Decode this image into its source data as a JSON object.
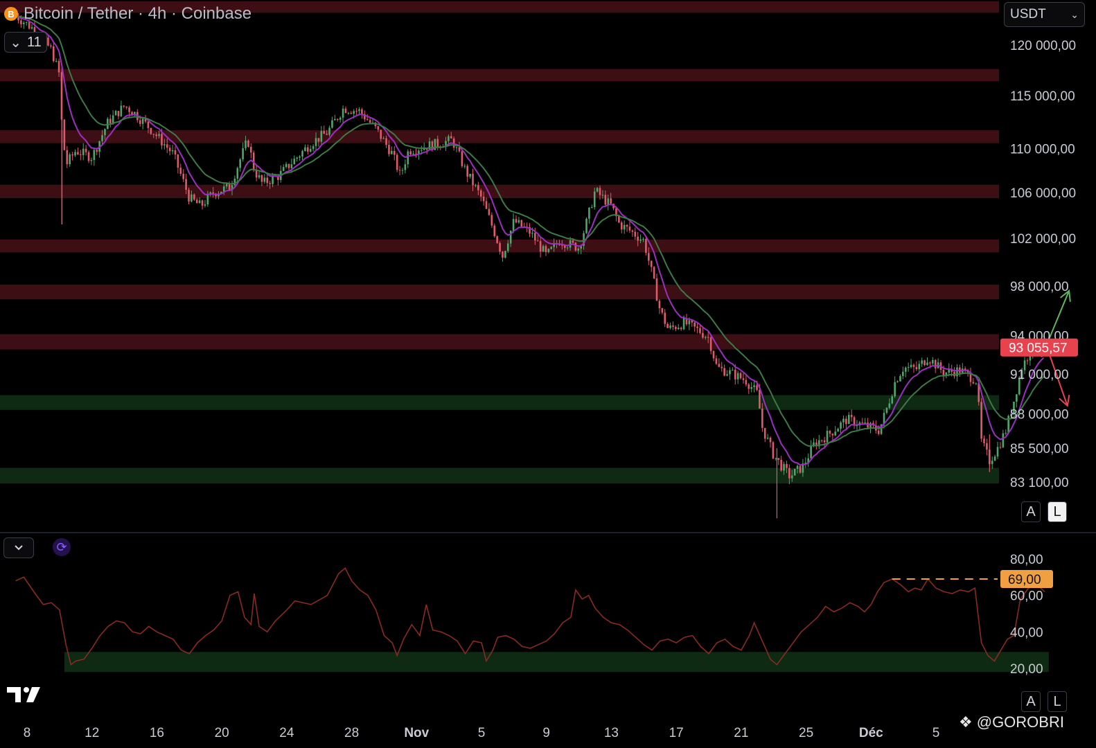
{
  "header": {
    "symbol_icon": "B",
    "title": "Bitcoin / Tether · 4h · Coinbase",
    "indicator_count": "11",
    "currency": "USDT",
    "scale_buttons": {
      "auto": "A",
      "log": "L"
    }
  },
  "footer": {
    "watermark": "@GOROBRI"
  },
  "colors": {
    "background": "#000000",
    "resistance_zone": "#3d0f14",
    "support_zone": "#0f2a12",
    "candle_up": "#4fa66a",
    "candle_down": "#e05a6a",
    "ema_fast": "#9b30c0",
    "ema_slow": "#3d7a47",
    "rsi_line": "#8a2a22",
    "price_label": "#e8424f",
    "rsi_label": "#f0a040",
    "arrow_up": "#5cb85c",
    "arrow_down": "#e8424f"
  },
  "chart_data": [
    {
      "type": "candlestick",
      "title": "Bitcoin / Tether · 4h · Coinbase",
      "timeframe": "4h",
      "y_scale": "log",
      "ylim": [
        80500,
        124500
      ],
      "x_range_days": [
        7.3,
        38.5
      ],
      "y_ticks": [
        "120 000,00",
        "115 000,00",
        "110 000,00",
        "106 000,00",
        "102 000,00",
        "98 000,00",
        "94 000,00",
        "91 000,00",
        "88 000,00",
        "85 500,00",
        "83 100,00"
      ],
      "y_tick_values": [
        120000,
        115000,
        110000,
        106000,
        102000,
        98000,
        94000,
        91000,
        88000,
        85500,
        83100
      ],
      "x_ticks": [
        "8",
        "12",
        "16",
        "20",
        "24",
        "28",
        "Nov",
        "5",
        "9",
        "13",
        "17",
        "21",
        "25",
        "Déc",
        "5"
      ],
      "x_tick_days": [
        8,
        12,
        16,
        20,
        24,
        28,
        32,
        36,
        40,
        44,
        48,
        52,
        56,
        60,
        64
      ],
      "last_price": "93 055,57",
      "resistance_zones": [
        [
          123300,
          124500
        ],
        [
          116400,
          117600
        ],
        [
          110500,
          111700
        ],
        [
          105500,
          106700
        ],
        [
          100800,
          101900
        ],
        [
          96900,
          98100
        ],
        [
          92900,
          94100
        ]
      ],
      "support_zones": [
        [
          88300,
          89400
        ],
        [
          83000,
          84100
        ]
      ],
      "price_path": [
        [
          7.3,
          123000
        ],
        [
          8.5,
          121500
        ],
        [
          9.5,
          119500
        ],
        [
          10.0,
          117000
        ],
        [
          10.15,
          112000
        ],
        [
          10.4,
          108500
        ],
        [
          11,
          109800
        ],
        [
          12,
          109200
        ],
        [
          13,
          112500
        ],
        [
          14,
          114000
        ],
        [
          14.5,
          113500
        ],
        [
          15.5,
          112000
        ],
        [
          17,
          109500
        ],
        [
          18,
          105500
        ],
        [
          18.7,
          104800
        ],
        [
          19.5,
          106000
        ],
        [
          20.5,
          106500
        ],
        [
          21,
          108500
        ],
        [
          21.6,
          110800
        ],
        [
          22,
          108000
        ],
        [
          22.5,
          106800
        ],
        [
          23.5,
          107500
        ],
        [
          24.5,
          109000
        ],
        [
          25.5,
          110500
        ],
        [
          26.5,
          111500
        ],
        [
          27.5,
          113800
        ],
        [
          28.5,
          113500
        ],
        [
          29.5,
          111800
        ],
        [
          30.5,
          109500
        ],
        [
          31,
          107500
        ],
        [
          31.5,
          109800
        ],
        [
          32.5,
          110200
        ],
        [
          33.5,
          110500
        ],
        [
          34.2,
          110800
        ],
        [
          35,
          108000
        ],
        [
          36,
          105500
        ],
        [
          36.8,
          102500
        ],
        [
          37.3,
          100500
        ],
        [
          38,
          103500
        ],
        [
          39,
          102500
        ],
        [
          40,
          100500
        ],
        [
          40.8,
          101800
        ],
        [
          42,
          101200
        ],
        [
          42.5,
          103500
        ],
        [
          43,
          106200
        ],
        [
          44,
          104800
        ],
        [
          44.5,
          103200
        ],
        [
          45,
          102800
        ],
        [
          46,
          101800
        ],
        [
          46.5,
          99000
        ],
        [
          47,
          96000
        ],
        [
          47.5,
          94500
        ],
        [
          48.5,
          95000
        ],
        [
          49.5,
          94300
        ],
        [
          50,
          93800
        ],
        [
          50.5,
          91500
        ],
        [
          51.5,
          91000
        ],
        [
          52.3,
          90500
        ],
        [
          53,
          89500
        ],
        [
          53.3,
          87000
        ],
        [
          54,
          85000
        ],
        [
          54.5,
          84200
        ],
        [
          55,
          83500
        ],
        [
          55.8,
          84200
        ],
        [
          56.5,
          85800
        ],
        [
          57.5,
          86600
        ],
        [
          58.5,
          87600
        ],
        [
          59.5,
          87200
        ],
        [
          60.5,
          86800
        ],
        [
          61,
          88500
        ],
        [
          61.5,
          90500
        ],
        [
          62,
          91500
        ],
        [
          62.8,
          91400
        ],
        [
          63.5,
          92300
        ],
        [
          64.5,
          91100
        ],
        [
          65.5,
          91300
        ],
        [
          66.5,
          90500
        ],
        [
          66.8,
          86000
        ],
        [
          67.3,
          84600
        ],
        [
          67.8,
          85500
        ],
        [
          68.3,
          86800
        ],
        [
          68.8,
          89000
        ],
        [
          69.3,
          91500
        ],
        [
          69.8,
          92800
        ],
        [
          70.3,
          93400
        ],
        [
          70.7,
          93055.57
        ]
      ],
      "series": [
        {
          "name": "EMA (fast)",
          "color": "#9b30c0"
        },
        {
          "name": "EMA (slow)",
          "color": "#3d7a47"
        }
      ],
      "annotations": [
        {
          "type": "arrow",
          "direction": "up",
          "from": [
            70.8,
            93200
          ],
          "to": [
            72.2,
            97600
          ],
          "color": "#5cb85c"
        },
        {
          "type": "arrow",
          "direction": "down",
          "from": [
            70.8,
            93200
          ],
          "to": [
            72.1,
            88600
          ],
          "color": "#e8424f"
        }
      ]
    },
    {
      "type": "line",
      "ylim": [
        12,
        88
      ],
      "y_ticks": [
        "80,00",
        "60,00",
        "40,00",
        "20,00"
      ],
      "y_tick_values": [
        80,
        60,
        40,
        20
      ],
      "current_value_label": "69,00",
      "level_line": 69,
      "oversold_zone": [
        18,
        29
      ],
      "values_path": [
        [
          7.3,
          68
        ],
        [
          7.8,
          70
        ],
        [
          8.5,
          61
        ],
        [
          9.0,
          55
        ],
        [
          9.5,
          56
        ],
        [
          10.0,
          52
        ],
        [
          10.4,
          33
        ],
        [
          10.7,
          22
        ],
        [
          11.0,
          24
        ],
        [
          11.5,
          25
        ],
        [
          12,
          31
        ],
        [
          12.5,
          38
        ],
        [
          13,
          43
        ],
        [
          13.5,
          46
        ],
        [
          14,
          45
        ],
        [
          14.5,
          40
        ],
        [
          15,
          39
        ],
        [
          15.5,
          43
        ],
        [
          16,
          40
        ],
        [
          16.5,
          38
        ],
        [
          17,
          36
        ],
        [
          17.5,
          30
        ],
        [
          18,
          28
        ],
        [
          18.5,
          34
        ],
        [
          19,
          38
        ],
        [
          19.5,
          41
        ],
        [
          20,
          46
        ],
        [
          20.5,
          60
        ],
        [
          21,
          62
        ],
        [
          21.4,
          48
        ],
        [
          21.8,
          44
        ],
        [
          22,
          61
        ],
        [
          22.3,
          43
        ],
        [
          22.8,
          40
        ],
        [
          23.3,
          46
        ],
        [
          24,
          52
        ],
        [
          24.5,
          57
        ],
        [
          25.5,
          55
        ],
        [
          26.5,
          60
        ],
        [
          27.2,
          72
        ],
        [
          27.6,
          75
        ],
        [
          28,
          68
        ],
        [
          28.5,
          63
        ],
        [
          29,
          60
        ],
        [
          29.5,
          52
        ],
        [
          30,
          38
        ],
        [
          30.5,
          34
        ],
        [
          30.8,
          27
        ],
        [
          31.2,
          36
        ],
        [
          31.7,
          44
        ],
        [
          32.2,
          38
        ],
        [
          32.6,
          55
        ],
        [
          33,
          41
        ],
        [
          33.5,
          40
        ],
        [
          34,
          38
        ],
        [
          34.5,
          35
        ],
        [
          35,
          28
        ],
        [
          35.5,
          35
        ],
        [
          36,
          34
        ],
        [
          36.3,
          24
        ],
        [
          36.7,
          30
        ],
        [
          37,
          37
        ],
        [
          37.5,
          38
        ],
        [
          38,
          36
        ],
        [
          38.5,
          32
        ],
        [
          39,
          31
        ],
        [
          39.5,
          33
        ],
        [
          40,
          35
        ],
        [
          40.5,
          39
        ],
        [
          41,
          45
        ],
        [
          41.5,
          48
        ],
        [
          41.8,
          63
        ],
        [
          42.2,
          58
        ],
        [
          42.6,
          60
        ],
        [
          43,
          53
        ],
        [
          43.5,
          48
        ],
        [
          44,
          45
        ],
        [
          44.5,
          44
        ],
        [
          45,
          41
        ],
        [
          45.5,
          37
        ],
        [
          46,
          33
        ],
        [
          46.5,
          30
        ],
        [
          47,
          35
        ],
        [
          47.5,
          36
        ],
        [
          48,
          34
        ],
        [
          48.5,
          37
        ],
        [
          49,
          38
        ],
        [
          49.5,
          32
        ],
        [
          50,
          28
        ],
        [
          50.5,
          34
        ],
        [
          51,
          36
        ],
        [
          51.5,
          32
        ],
        [
          52,
          30
        ],
        [
          52.5,
          38
        ],
        [
          52.8,
          45
        ],
        [
          53.3,
          35
        ],
        [
          53.8,
          25
        ],
        [
          54.2,
          22
        ],
        [
          54.7,
          28
        ],
        [
          55.2,
          34
        ],
        [
          55.7,
          40
        ],
        [
          56.2,
          44
        ],
        [
          56.7,
          48
        ],
        [
          57.2,
          54
        ],
        [
          57.7,
          51
        ],
        [
          58.2,
          53
        ],
        [
          58.7,
          56
        ],
        [
          59.2,
          54
        ],
        [
          59.6,
          51
        ],
        [
          60.0,
          55
        ],
        [
          60.4,
          62
        ],
        [
          60.8,
          67
        ],
        [
          61.3,
          69
        ],
        [
          61.8,
          66
        ],
        [
          62.3,
          62
        ],
        [
          62.7,
          64
        ],
        [
          63.1,
          63
        ],
        [
          63.5,
          69
        ],
        [
          64,
          64
        ],
        [
          64.5,
          62
        ],
        [
          65,
          61
        ],
        [
          65.5,
          63
        ],
        [
          66,
          62
        ],
        [
          66.4,
          64
        ],
        [
          66.8,
          34
        ],
        [
          67.2,
          27
        ],
        [
          67.6,
          24
        ],
        [
          68.0,
          30
        ],
        [
          68.4,
          36
        ],
        [
          68.8,
          38
        ],
        [
          69.2,
          58
        ],
        [
          69.7,
          64
        ],
        [
          70.2,
          66
        ],
        [
          70.7,
          62
        ]
      ]
    }
  ]
}
